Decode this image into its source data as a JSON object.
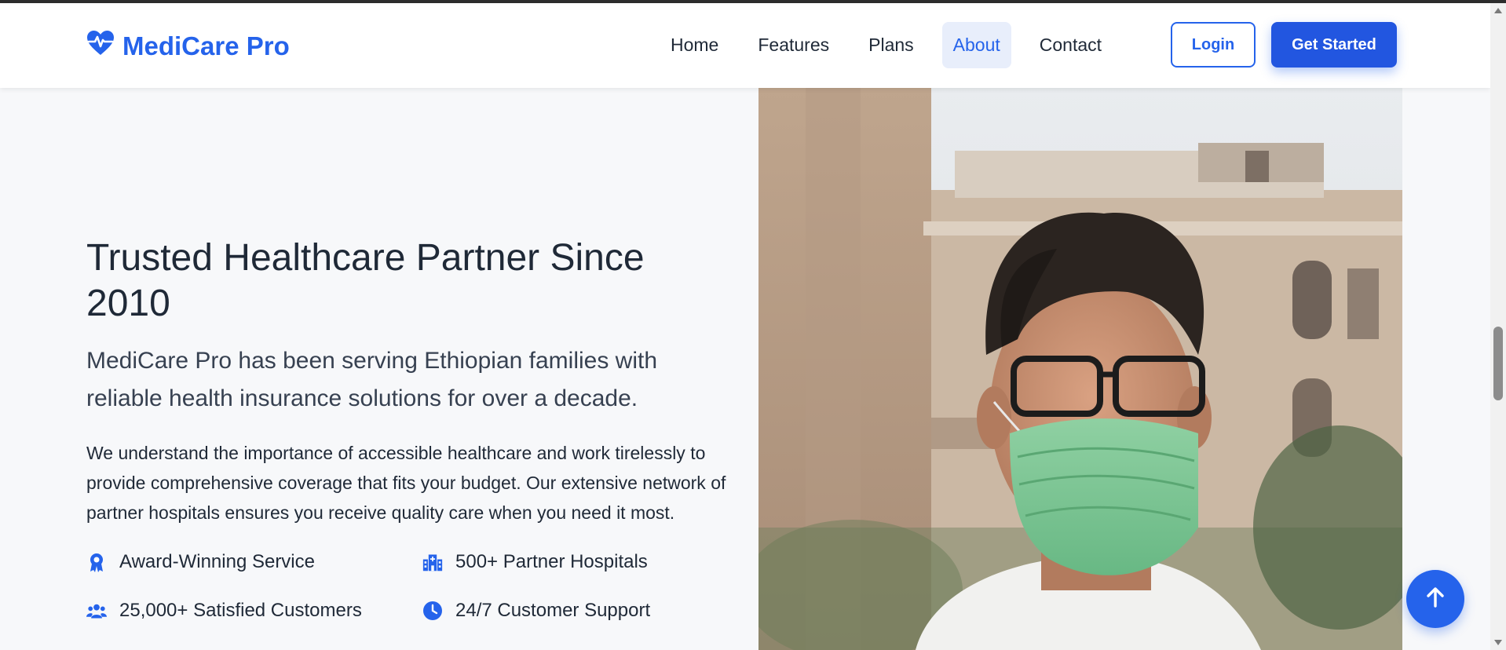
{
  "brand": {
    "name": "MediCare Pro",
    "icon": "heart-pulse-icon",
    "color": "#2563eb"
  },
  "nav": {
    "items": [
      {
        "label": "Home",
        "active": false
      },
      {
        "label": "Features",
        "active": false
      },
      {
        "label": "Plans",
        "active": false
      },
      {
        "label": "About",
        "active": true
      },
      {
        "label": "Contact",
        "active": false
      }
    ]
  },
  "actions": {
    "login_label": "Login",
    "get_started_label": "Get Started"
  },
  "about": {
    "title": "Trusted Healthcare Partner Since 2010",
    "lead": "MediCare Pro has been serving Ethiopian families with reliable health insurance solutions for over a decade.",
    "body": "We understand the importance of accessible healthcare and work tirelessly to provide comprehensive coverage that fits your budget. Our extensive network of partner hospitals ensures you receive quality care when you need it most.",
    "features": [
      {
        "icon": "award-icon",
        "label": "Award-Winning Service"
      },
      {
        "icon": "hospital-icon",
        "label": "500+ Partner Hospitals"
      },
      {
        "icon": "users-icon",
        "label": "25,000+ Satisfied Customers"
      },
      {
        "icon": "clock-icon",
        "label": "24/7 Customer Support"
      }
    ]
  },
  "image": {
    "subject": "doctor-with-face-mask-photo"
  },
  "scroll_top": {
    "icon": "arrow-up-icon"
  },
  "colors": {
    "primary": "#2563eb",
    "nav_active_bg": "#e8eefb",
    "page_bg": "#f7f8fa"
  }
}
